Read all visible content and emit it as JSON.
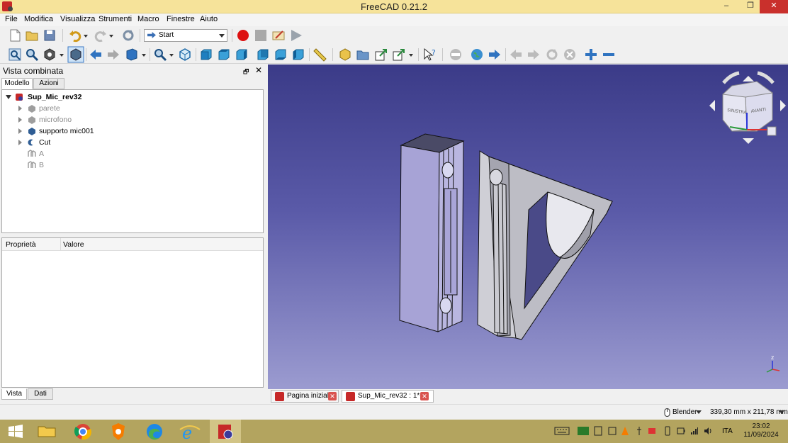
{
  "window": {
    "title": "FreeCAD 0.21.2",
    "minimize": "–",
    "restore": "❐",
    "close": "✕"
  },
  "menu": [
    "File",
    "Modifica",
    "Visualizza",
    "Strumenti",
    "Macro",
    "Finestre",
    "Aiuto"
  ],
  "toolbar": {
    "workbench": "Start"
  },
  "combo": {
    "title": "Vista combinata",
    "float_glyph": "🗗",
    "close_glyph": "✕",
    "tabs": [
      "Modello",
      "Azioni"
    ],
    "bottom_tabs": [
      "Vista",
      "Dati"
    ]
  },
  "tree": {
    "root": "Sup_Mic_rev32",
    "items": [
      {
        "label": "parete",
        "hidden": true
      },
      {
        "label": "microfono",
        "hidden": true
      },
      {
        "label": "supporto mic001",
        "hidden": false
      },
      {
        "label": "Cut",
        "hidden": false
      },
      {
        "label": "A",
        "hidden": true
      },
      {
        "label": "B",
        "hidden": true
      }
    ]
  },
  "properties": {
    "col_property": "Proprietà",
    "col_value": "Valore"
  },
  "navcube": {
    "left_face": "SINISTRA",
    "front_face": "AVANTI"
  },
  "axis": {
    "z": "z"
  },
  "doc_tabs": [
    {
      "label": "Pagina iniziale",
      "active": false
    },
    {
      "label": "Sup_Mic_rev32 : 1*",
      "active": true
    }
  ],
  "status": {
    "nav_style": "Blender",
    "dimensions": "339,30 mm x 211,78 mm"
  },
  "taskbar": {
    "lang": "ITA",
    "time": "23:02",
    "date": "11/09/2024"
  },
  "colors": {
    "titlebar": "#f6e39a",
    "taskbar": "#b3a45f",
    "viewport_top": "#3b3b88",
    "viewport_bottom": "#9b9bd0"
  }
}
